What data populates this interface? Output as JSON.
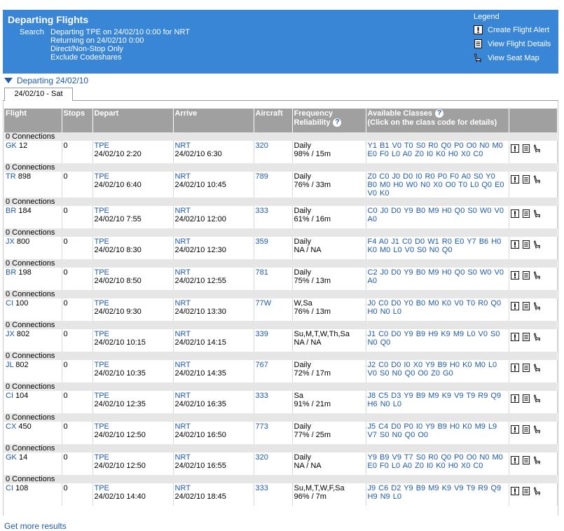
{
  "header": {
    "title": "Departing Flights",
    "search_label": "Search",
    "search_lines": [
      "Departing TPE on 24/02/10 0:00 for NRT",
      "Returning on 24/02/10 0:00",
      "Direct/Non-Stop Only",
      "Exclude Codeshares"
    ],
    "legend_title": "Legend",
    "legend": [
      {
        "icon": "alert-icon",
        "label": "Create Flight Alert"
      },
      {
        "icon": "details-icon",
        "label": "View Flight Details"
      },
      {
        "icon": "seat-icon",
        "label": "View Seat Map"
      }
    ]
  },
  "section": {
    "title": "Departing 24/02/10",
    "tab": "24/02/10 - Sat"
  },
  "columns": {
    "flight": "Flight",
    "stops": "Stops",
    "depart": "Depart",
    "arrive": "Arrive",
    "aircraft": "Aircraft",
    "frequency": "Frequency",
    "reliability": "Reliability",
    "classes": "Available Classes",
    "classes_note": "(Click on the class code for details)"
  },
  "flights": [
    {
      "conn": "0 Connections",
      "airline": "GK",
      "num": "12",
      "stops": "0",
      "dep_code": "TPE",
      "dep_time": "24/02/10 2:20",
      "arr_code": "NRT",
      "arr_time": "24/02/10 6:30",
      "aircraft": "320",
      "freq": "Daily",
      "rel": "98% / 15m",
      "classes": "Y1 B1 V0 T0 S0 R0 Q0 P0 O0 N0 M0 E0 F0 L0 A0 Z0 I0 K0 H0 X0 C0"
    },
    {
      "conn": "0 Connections",
      "airline": "TR",
      "num": "898",
      "stops": "0",
      "dep_code": "TPE",
      "dep_time": "24/02/10 6:40",
      "arr_code": "NRT",
      "arr_time": "24/02/10 10:45",
      "aircraft": "789",
      "freq": "Daily",
      "rel": "76% / 33m",
      "classes": "Z0 C0 J0 D0 I0 R0 P0 F0 A0 S0 Y0 B0 M0 H0 W0 N0 X0 O0 T0 L0 Q0 E0 V0 K0"
    },
    {
      "conn": "0 Connections",
      "airline": "BR",
      "num": "184",
      "stops": "0",
      "dep_code": "TPE",
      "dep_time": "24/02/10 7:55",
      "arr_code": "NRT",
      "arr_time": "24/02/10 12:00",
      "aircraft": "333",
      "freq": "Daily",
      "rel": "61% / 16m",
      "classes": "C0 J0 D0 Y9 B0 M9 H0 Q0 S0 W0 V0 A0"
    },
    {
      "conn": "0 Connections",
      "airline": "JX",
      "num": "800",
      "stops": "0",
      "dep_code": "TPE",
      "dep_time": "24/02/10 8:30",
      "arr_code": "NRT",
      "arr_time": "24/02/10 12:30",
      "aircraft": "359",
      "freq": "Daily",
      "rel": "NA / NA",
      "classes": "F4 A0 J1 C0 D0 W1 R0 E0 Y7 B6 H0 K0 M0 L0 V0 S0 N0 Q0"
    },
    {
      "conn": "0 Connections",
      "airline": "BR",
      "num": "198",
      "stops": "0",
      "dep_code": "TPE",
      "dep_time": "24/02/10 8:50",
      "arr_code": "NRT",
      "arr_time": "24/02/10 12:55",
      "aircraft": "781",
      "freq": "Daily",
      "rel": "75% / 13m",
      "classes": "C2 J0 D0 Y9 B0 M9 H0 Q0 S0 W0 V0 A0"
    },
    {
      "conn": "0 Connections",
      "airline": "CI",
      "num": "100",
      "stops": "0",
      "dep_code": "TPE",
      "dep_time": "24/02/10 9:30",
      "arr_code": "NRT",
      "arr_time": "24/02/10 13:30",
      "aircraft": "77W",
      "freq": "W,Sa",
      "rel": "76% / 13m",
      "classes": "J0 C0 D0 Y0 B0 M0 K0 V0 T0 R0 Q0 H0 N0 L0"
    },
    {
      "conn": "0 Connections",
      "airline": "JX",
      "num": "802",
      "stops": "0",
      "dep_code": "TPE",
      "dep_time": "24/02/10 10:15",
      "arr_code": "NRT",
      "arr_time": "24/02/10 14:15",
      "aircraft": "339",
      "freq": "Su,M,T,W,Th,Sa",
      "rel": "NA / NA",
      "classes": "J1 C0 D0 Y9 B9 H9 K9 M9 L0 V0 S0 N0 Q0"
    },
    {
      "conn": "0 Connections",
      "airline": "JL",
      "num": "802",
      "stops": "0",
      "dep_code": "TPE",
      "dep_time": "24/02/10 10:35",
      "arr_code": "NRT",
      "arr_time": "24/02/10 14:35",
      "aircraft": "767",
      "freq": "Daily",
      "rel": "72% / 17m",
      "classes": "J2 C0 D0 I0 X0 Y9 B9 H0 K0 M0 L0 V0 S0 N0 Q0 O0 Z0 G0"
    },
    {
      "conn": "0 Connections",
      "airline": "CI",
      "num": "104",
      "stops": "0",
      "dep_code": "TPE",
      "dep_time": "24/02/10 12:35",
      "arr_code": "NRT",
      "arr_time": "24/02/10 16:35",
      "aircraft": "333",
      "freq": "Sa",
      "rel": "91% / 21m",
      "classes": "J8 C5 D3 Y9 B9 M9 K9 V9 T9 R9 Q9 H6 N0 L0"
    },
    {
      "conn": "0 Connections",
      "airline": "CX",
      "num": "450",
      "stops": "0",
      "dep_code": "TPE",
      "dep_time": "24/02/10 12:50",
      "arr_code": "NRT",
      "arr_time": "24/02/10 16:50",
      "aircraft": "773",
      "freq": "Daily",
      "rel": "77% / 25m",
      "classes": "J5 C4 D0 P0 I0 Y9 B9 H0 K0 M9 L9 V7 S0 N0 Q0 O0"
    },
    {
      "conn": "0 Connections",
      "airline": "GK",
      "num": "14",
      "stops": "0",
      "dep_code": "TPE",
      "dep_time": "24/02/10 12:50",
      "arr_code": "NRT",
      "arr_time": "24/02/10 16:55",
      "aircraft": "320",
      "freq": "Daily",
      "rel": "NA / NA",
      "classes": "Y9 B9 V9 T7 S0 R0 Q0 P0 O0 N0 M0 E0 F0 L0 A0 Z0 I0 K0 H0 X0 C0"
    },
    {
      "conn": "0 Connections",
      "airline": "CI",
      "num": "108",
      "stops": "0",
      "dep_code": "TPE",
      "dep_time": "24/02/10 14:40",
      "arr_code": "NRT",
      "arr_time": "24/02/10 18:45",
      "aircraft": "333",
      "freq": "Su,M,T,W,F,Sa",
      "rel": "96% / 7m",
      "classes": "J9 C6 D2 Y9 B9 M9 K9 V9 T9 R9 Q9 H9 N9 L0"
    }
  ],
  "footer": {
    "more": "Get more results"
  }
}
